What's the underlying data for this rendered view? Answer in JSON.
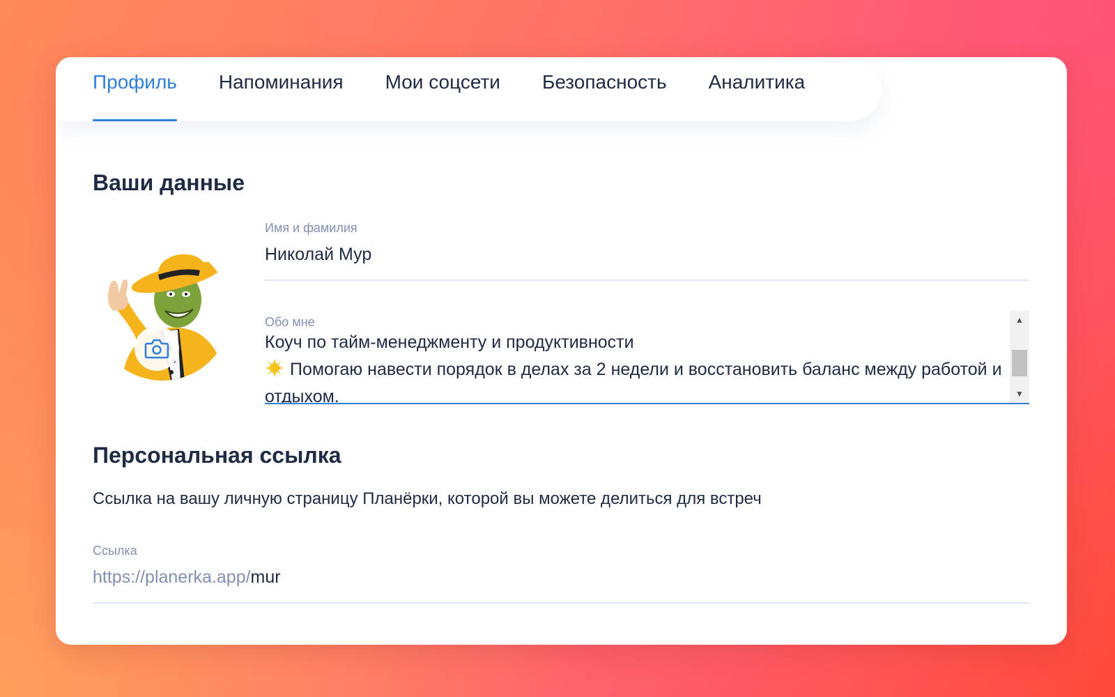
{
  "tabs": [
    {
      "label": "Профиль",
      "active": true
    },
    {
      "label": "Напоминания",
      "active": false
    },
    {
      "label": "Мои соцсети",
      "active": false
    },
    {
      "label": "Безопасность",
      "active": false
    },
    {
      "label": "Аналитика",
      "active": false
    }
  ],
  "profile": {
    "section_title": "Ваши данные",
    "avatar_icon": "camera-icon",
    "name_label": "Имя и фамилия",
    "name_value": "Николай Мур",
    "about_label": "Обо мне",
    "about_line1": "Коуч по тайм-менеджменту и продуктивности",
    "about_emoji": "sun-emoji",
    "about_line2": "Помогаю навести порядок в делах за 2 недели и восстановить баланс между работой и отдыхом."
  },
  "personal_link": {
    "section_title": "Персональная ссылка",
    "description": "Ссылка на вашу личную страницу Планёрки, которой вы можете делиться для встреч",
    "label": "Ссылка",
    "prefix": "https://planerka.app/",
    "value": "mur"
  },
  "colors": {
    "accent": "#2f80dd",
    "text": "#1f2a44",
    "muted": "#8390b4",
    "divider": "#dfe6f5"
  }
}
